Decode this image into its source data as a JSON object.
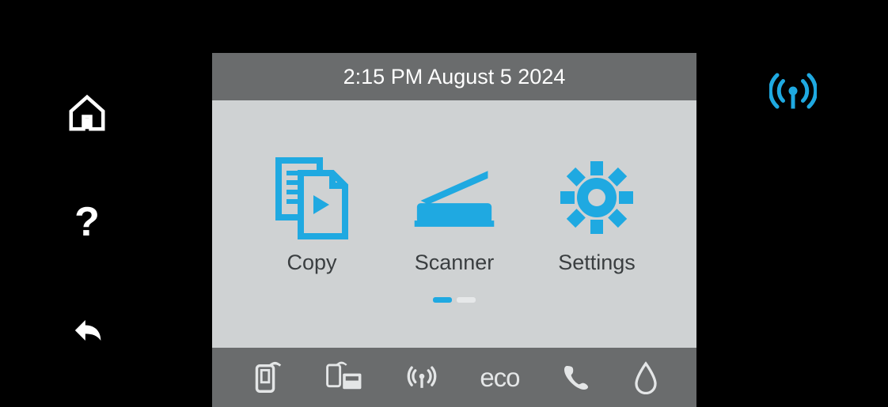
{
  "status_bar": {
    "datetime": "2:15 PM August 5 2024"
  },
  "apps": [
    {
      "label": "Copy",
      "icon": "copy"
    },
    {
      "label": "Scanner",
      "icon": "scanner"
    },
    {
      "label": "Settings",
      "icon": "settings"
    }
  ],
  "pagination": {
    "pages": 2,
    "active": 0
  },
  "bottom_icons": [
    {
      "name": "touch-print",
      "label": ""
    },
    {
      "name": "print-anywhere",
      "label": ""
    },
    {
      "name": "wireless",
      "label": ""
    },
    {
      "name": "eco",
      "label": "eco"
    },
    {
      "name": "phone",
      "label": ""
    },
    {
      "name": "ink",
      "label": ""
    }
  ],
  "colors": {
    "accent": "#1fa9e1",
    "panel": "#cfd2d3",
    "bar": "#6a6c6d",
    "text_dark": "#3a3e40"
  }
}
